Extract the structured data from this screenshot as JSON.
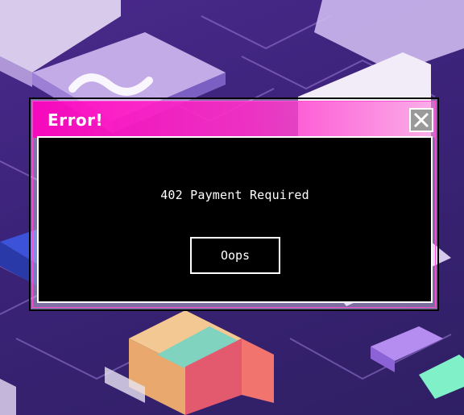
{
  "dialog": {
    "title": "Error!",
    "message": "402 Payment Required",
    "button_label": "Oops",
    "close_icon": "close-icon"
  },
  "colors": {
    "titlebar": "#ff00be",
    "content_bg": "#000000",
    "text": "#ffffff",
    "close_button_bg": "#9a9a9a",
    "background": "#3c237a"
  }
}
